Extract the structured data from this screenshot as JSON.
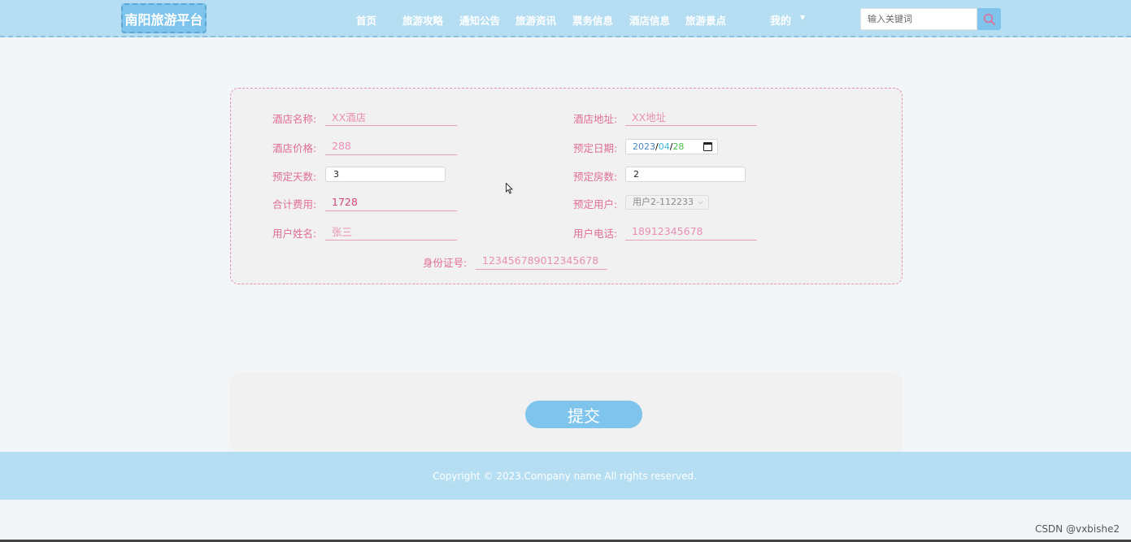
{
  "header": {
    "logo": "南阳旅游平台",
    "nav": [
      "首页",
      "旅游攻略",
      "通知公告",
      "旅游资讯",
      "票务信息",
      "酒店信息",
      "旅游景点"
    ],
    "me": "我的",
    "search_placeholder": "输入关键词"
  },
  "form": {
    "hotel_name": {
      "label": "酒店名称:",
      "value": "XX酒店"
    },
    "hotel_address": {
      "label": "酒店地址:",
      "value": "XX地址"
    },
    "hotel_price": {
      "label": "酒店价格:",
      "value": "288"
    },
    "booking_date": {
      "label": "预定日期:",
      "year": "2023",
      "month": "04",
      "day": "28",
      "sep": "/"
    },
    "booking_days": {
      "label": "预定天数:",
      "value": "3"
    },
    "room_count": {
      "label": "预定房数:",
      "value": "2"
    },
    "total_cost": {
      "label": "合计费用:",
      "value": "1728"
    },
    "booking_user": {
      "label": "预定用户:",
      "value": "用户2-112233"
    },
    "user_name": {
      "label": "用户姓名:",
      "value": "张三"
    },
    "user_phone": {
      "label": "用户电话:",
      "value": "18912345678"
    },
    "id_number": {
      "label": "身份证号:",
      "value": "123456789012345678"
    }
  },
  "submit_label": "提交",
  "footer": "Copyright © 2023.Company name All rights reserved.",
  "watermark": "CSDN @vxbishe2",
  "colors": {
    "header_bg": "#b5def2",
    "accent_blue": "#7ec4ec",
    "label_pink": "#e06d98",
    "card_bg": "#f2f1f1"
  }
}
